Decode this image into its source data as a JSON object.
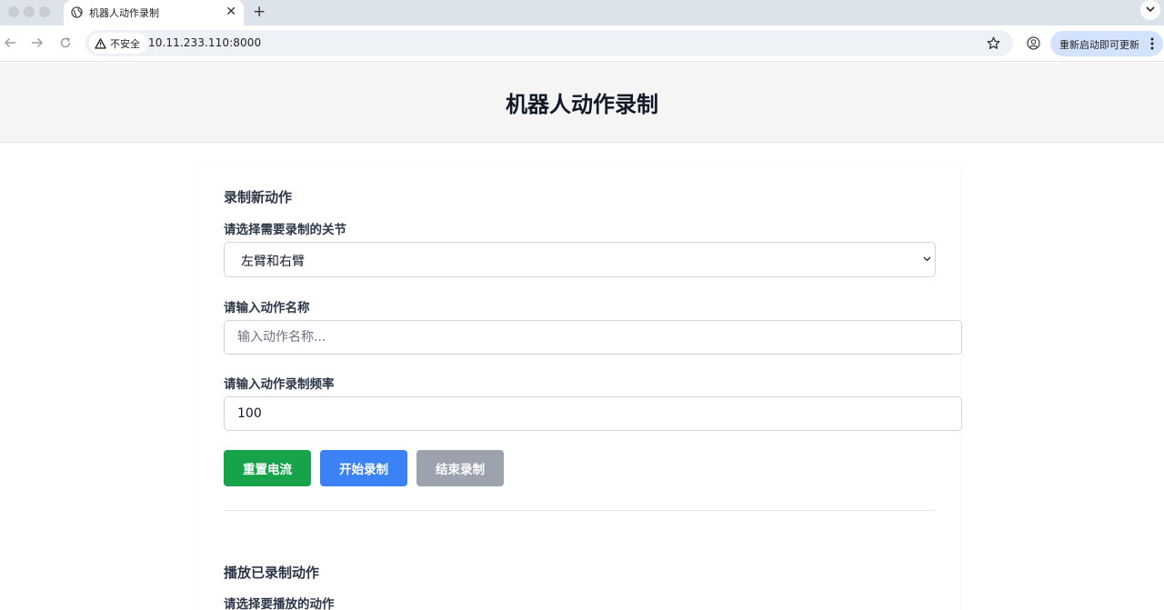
{
  "browser": {
    "tab_title": "机器人动作录制",
    "new_tab_label": "+",
    "close_label": "✕",
    "security_label": "不安全",
    "url": "10.11.233.110:8000",
    "update_label": "重新启动即可更新"
  },
  "page": {
    "title": "机器人动作录制"
  },
  "record_section": {
    "title": "录制新动作",
    "joints_label": "请选择需要录制的关节",
    "joints_selected": "左臂和右臂",
    "name_label": "请输入动作名称",
    "name_placeholder": "输入动作名称...",
    "frequency_label": "请输入动作录制频率",
    "frequency_value": "100",
    "buttons": {
      "reset_current": "重置电流",
      "start_recording": "开始录制",
      "stop_recording": "结束录制"
    }
  },
  "playback_section": {
    "title": "播放已录制动作",
    "select_label": "请选择要播放的动作"
  },
  "colors": {
    "green_button": "#16a34a",
    "blue_button": "#3b82f6",
    "gray_button": "#9ca3af",
    "update_chip": "#d3e3fd"
  }
}
